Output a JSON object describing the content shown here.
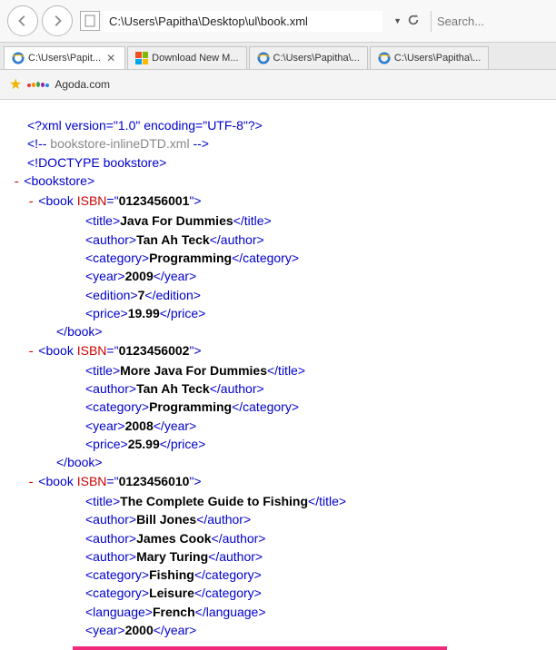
{
  "toolbar": {
    "address": "C:\\Users\\Papitha\\Desktop\\ul\\book.xml",
    "search_placeholder": "Search..."
  },
  "tabs": [
    {
      "label": "C:\\Users\\Papit...",
      "type": "ie",
      "active": true,
      "closable": true
    },
    {
      "label": "Download New M...",
      "type": "ms",
      "active": false,
      "closable": false
    },
    {
      "label": "C:\\Users\\Papitha\\...",
      "type": "ie",
      "active": false,
      "closable": false
    },
    {
      "label": "C:\\Users\\Papitha\\...",
      "type": "ie",
      "active": false,
      "closable": false
    }
  ],
  "favbar": {
    "link": "Agoda.com"
  },
  "xml": {
    "decl": "<?xml version=\"1.0\" encoding=\"UTF-8\"?>",
    "comment_open": "<!--",
    "comment_text": " bookstore-inlineDTD.xml ",
    "comment_close": "-->",
    "doctype": "<!DOCTYPE bookstore>",
    "root": "bookstore",
    "books": [
      {
        "isbn": "0123456001",
        "children": [
          {
            "tag": "title",
            "text": "Java For Dummies"
          },
          {
            "tag": "author",
            "text": "Tan Ah Teck"
          },
          {
            "tag": "category",
            "text": "Programming"
          },
          {
            "tag": "year",
            "text": "2009"
          },
          {
            "tag": "edition",
            "text": "7"
          },
          {
            "tag": "price",
            "text": "19.99"
          }
        ],
        "closed": true
      },
      {
        "isbn": "0123456002",
        "children": [
          {
            "tag": "title",
            "text": "More Java For Dummies"
          },
          {
            "tag": "author",
            "text": "Tan Ah Teck"
          },
          {
            "tag": "category",
            "text": "Programming"
          },
          {
            "tag": "year",
            "text": "2008"
          },
          {
            "tag": "price",
            "text": "25.99"
          }
        ],
        "closed": true
      },
      {
        "isbn": "0123456010",
        "children": [
          {
            "tag": "title",
            "text": "The Complete Guide to Fishing"
          },
          {
            "tag": "author",
            "text": "Bill Jones"
          },
          {
            "tag": "author",
            "text": "James Cook"
          },
          {
            "tag": "author",
            "text": "Mary Turing"
          },
          {
            "tag": "category",
            "text": "Fishing"
          },
          {
            "tag": "category",
            "text": "Leisure"
          },
          {
            "tag": "language",
            "text": "French"
          },
          {
            "tag": "year",
            "text": "2000"
          }
        ],
        "closed": false
      }
    ]
  }
}
